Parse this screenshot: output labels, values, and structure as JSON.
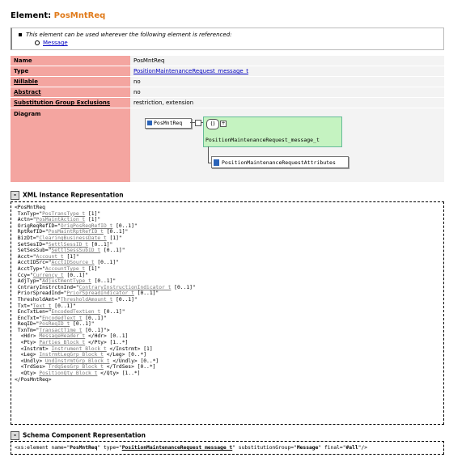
{
  "element_title": {
    "label": "Element:",
    "name": "PosMntReq"
  },
  "note": {
    "text": "This element can be used wherever the following element is referenced:",
    "link": "Message"
  },
  "properties": [
    {
      "key": "Name",
      "value": "PosMntReq",
      "underline": false,
      "link": false
    },
    {
      "key": "Type",
      "value": "PositionMaintenanceRequest_message_t",
      "underline": false,
      "link": true
    },
    {
      "key": "Nillable",
      "value": "no",
      "underline": true,
      "link": false
    },
    {
      "key": "Abstract",
      "value": "no",
      "underline": true,
      "link": false
    },
    {
      "key": "Substitution Group Exclusions",
      "value": "restriction, extension",
      "underline": true,
      "link": false
    }
  ],
  "diagram": {
    "key": "Diagram",
    "element_box": "PosMntReq",
    "sequence_symbol": "()",
    "type_label": "PositionMaintenanceRequest_message_t",
    "attributes_label": "PositionMaintenanceRequestAttributes"
  },
  "xml_section": {
    "toggle": "-",
    "title": "XML Instance Representation",
    "lines": [
      [
        [
          "",
          "<PosMntReq"
        ]
      ],
      [
        [
          "",
          " TxnTyp=\""
        ],
        [
          "t",
          "PosTransType_t"
        ],
        [
          "",
          " [1]\""
        ]
      ],
      [
        [
          "",
          " Actn=\""
        ],
        [
          "t",
          "PosMaintAction_t"
        ],
        [
          "",
          " [1]\""
        ]
      ],
      [
        [
          "",
          " OrigReqRefID=\""
        ],
        [
          "t",
          "OrigPosReqRefID_t"
        ],
        [
          "",
          " [0..1]\""
        ]
      ],
      [
        [
          "",
          " RptRefID=\""
        ],
        [
          "t",
          "PosMaintRptRefID_t"
        ],
        [
          "",
          " [0..1]\""
        ]
      ],
      [
        [
          "",
          " BizDt=\""
        ],
        [
          "t",
          "ClearingBusinessDate_t"
        ],
        [
          "",
          " [1]\""
        ]
      ],
      [
        [
          "",
          " SetSesID=\""
        ],
        [
          "t",
          "SettlSessID_t"
        ],
        [
          "",
          " [0..1]\""
        ]
      ],
      [
        [
          "",
          " SetSesSub=\""
        ],
        [
          "t",
          "SettlSessSubID_t"
        ],
        [
          "",
          " [0..1]\""
        ]
      ],
      [
        [
          "",
          " Acct=\""
        ],
        [
          "t",
          "Account_t"
        ],
        [
          "",
          " [1]\""
        ]
      ],
      [
        [
          "",
          " AcctIDSrc=\""
        ],
        [
          "t",
          "AcctIDSource_t"
        ],
        [
          "",
          " [0..1]\""
        ]
      ],
      [
        [
          "",
          " AcctTyp=\""
        ],
        [
          "t",
          "AccountType_t"
        ],
        [
          "",
          " [1]\""
        ]
      ],
      [
        [
          "",
          " Ccy=\""
        ],
        [
          "t",
          "Currency_t"
        ],
        [
          "",
          " [0..1]\""
        ]
      ],
      [
        [
          "",
          " AdjTyp=\""
        ],
        [
          "t",
          "AdjustmentType_t"
        ],
        [
          "",
          " [0..1]\""
        ]
      ],
      [
        [
          "",
          " CntraryInstrctnInd=\""
        ],
        [
          "t",
          "ContraryInstructionIndicator_t"
        ],
        [
          "",
          " [0..1]\""
        ]
      ],
      [
        [
          "",
          " PriorSpreadInd=\""
        ],
        [
          "t",
          "PriorSpreadIndicator_t"
        ],
        [
          "",
          " [0..1]\""
        ]
      ],
      [
        [
          "",
          " ThresholdAmt=\""
        ],
        [
          "t",
          "ThresholdAmount_t"
        ],
        [
          "",
          " [0..1]\""
        ]
      ],
      [
        [
          "",
          " Txt=\""
        ],
        [
          "t",
          "Text_t"
        ],
        [
          "",
          " [0..1]\""
        ]
      ],
      [
        [
          "",
          " EncTxtLen=\""
        ],
        [
          "t",
          "EncodedTextLen_t"
        ],
        [
          "",
          " [0..1]\""
        ]
      ],
      [
        [
          "",
          " EncTxt=\""
        ],
        [
          "t",
          "EncodedText_t"
        ],
        [
          "",
          " [0..1]\""
        ]
      ],
      [
        [
          "",
          " ReqID=\""
        ],
        [
          "t",
          "PosReqID_t"
        ],
        [
          "",
          " [0..1]\""
        ]
      ],
      [
        [
          "",
          " TxnTm=\""
        ],
        [
          "t",
          "TransactTime_t"
        ],
        [
          "",
          " [0..1]\">"
        ]
      ],
      [
        [
          "",
          "  <Hdr> "
        ],
        [
          "t",
          "MessageHeader_t"
        ],
        [
          "",
          " </Hdr> [0..1]"
        ]
      ],
      [
        [
          "",
          "  <Pty> "
        ],
        [
          "t",
          "Parties_Block_t"
        ],
        [
          "",
          " </Pty> [1..*]"
        ]
      ],
      [
        [
          "",
          "  <Instrmt> "
        ],
        [
          "t",
          "Instrument_Block_t"
        ],
        [
          "",
          " </Instrmt> [1]"
        ]
      ],
      [
        [
          "",
          "  <Leg> "
        ],
        [
          "t",
          "InstrmtLegGrp_Block_t"
        ],
        [
          "",
          " </Leg> [0..*]"
        ]
      ],
      [
        [
          "",
          "  <Undly> "
        ],
        [
          "t",
          "UndInstrmtGrp_Block_t"
        ],
        [
          "",
          " </Undly> [0..*]"
        ]
      ],
      [
        [
          "",
          "  <TrdSes> "
        ],
        [
          "t",
          "TrdgSesGrp_Block_t"
        ],
        [
          "",
          " </TrdSes> [0..*]"
        ]
      ],
      [
        [
          "",
          "  <Qty> "
        ],
        [
          "t",
          "PositionQty_Block_t"
        ],
        [
          "",
          " </Qty> [1..*]"
        ]
      ],
      [
        [
          "",
          "</PosMntReq>"
        ]
      ]
    ]
  },
  "schema_section": {
    "toggle": "-",
    "title": "Schema Component Representation",
    "code": {
      "open": "<xs:element name=\"",
      "name": "PosMntReq",
      "type_attr": "\" type=\"",
      "type": "PositionMaintenanceRequest_message_t",
      "subst_attr": "\" substitutionGroup=\"",
      "subst": "Message",
      "final_attr": "\" final=\"",
      "final": "#all",
      "close": "\"/>"
    }
  }
}
